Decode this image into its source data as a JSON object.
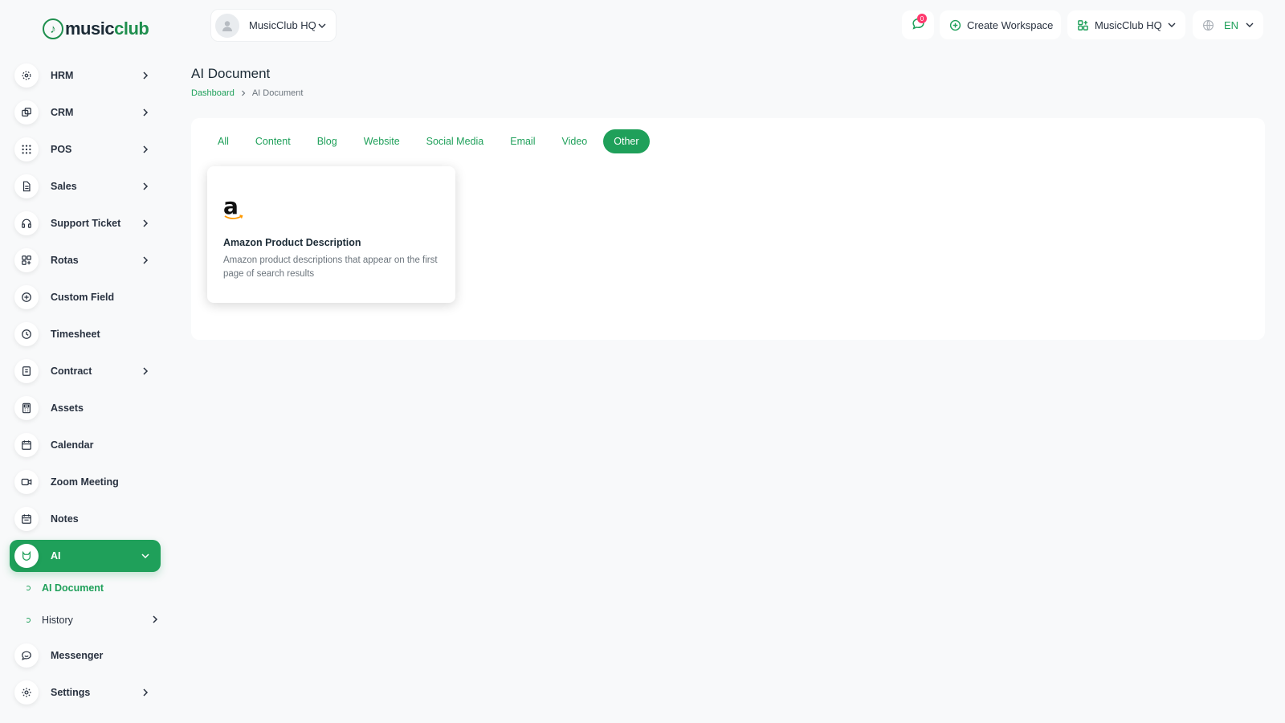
{
  "brand": {
    "name_part1": "music",
    "name_part2": "club",
    "accent": "#1fa05a"
  },
  "header": {
    "workspace_switcher": {
      "name": "MusicClub HQ"
    },
    "messages_badge": "0",
    "create_workspace_label": "Create Workspace",
    "workspace_menu_label": "MusicClub HQ",
    "language_label": "EN"
  },
  "sidebar": {
    "items": [
      {
        "label": "HRM",
        "icon": "hrm-icon",
        "chevron": true
      },
      {
        "label": "CRM",
        "icon": "crm-icon",
        "chevron": true
      },
      {
        "label": "POS",
        "icon": "grid-icon",
        "chevron": true
      },
      {
        "label": "Sales",
        "icon": "file-icon",
        "chevron": true
      },
      {
        "label": "Support Ticket",
        "icon": "headphones-icon",
        "chevron": true
      },
      {
        "label": "Rotas",
        "icon": "apps-icon",
        "chevron": true
      },
      {
        "label": "Custom Field",
        "icon": "plus-circle-icon",
        "chevron": false
      },
      {
        "label": "Timesheet",
        "icon": "clock-icon",
        "chevron": false
      },
      {
        "label": "Contract",
        "icon": "contract-icon",
        "chevron": true
      },
      {
        "label": "Assets",
        "icon": "calculator-icon",
        "chevron": false
      },
      {
        "label": "Calendar",
        "icon": "calendar-icon",
        "chevron": false
      },
      {
        "label": "Zoom Meeting",
        "icon": "video-icon",
        "chevron": false
      },
      {
        "label": "Notes",
        "icon": "notes-icon",
        "chevron": false
      },
      {
        "label": "AI",
        "icon": "ai-icon",
        "chevron": true,
        "active": true
      }
    ],
    "ai_sub_items": [
      {
        "label": "AI Document",
        "active": true
      },
      {
        "label": "History",
        "chevron": true
      }
    ],
    "bottom_items": [
      {
        "label": "Messenger",
        "icon": "chat-icon"
      },
      {
        "label": "Settings",
        "icon": "gear-icon",
        "chevron": true
      }
    ]
  },
  "main": {
    "title": "AI Document",
    "breadcrumb": {
      "home": "Dashboard",
      "current": "AI Document"
    },
    "tabs": [
      "All",
      "Content",
      "Blog",
      "Website",
      "Social Media",
      "Email",
      "Video",
      "Other"
    ],
    "active_tab": "Other",
    "documents": [
      {
        "logo": "amazon-logo",
        "logo_text": "a",
        "title": "Amazon Product Description",
        "description": "Amazon product descriptions that appear on the first page of search results"
      }
    ]
  }
}
